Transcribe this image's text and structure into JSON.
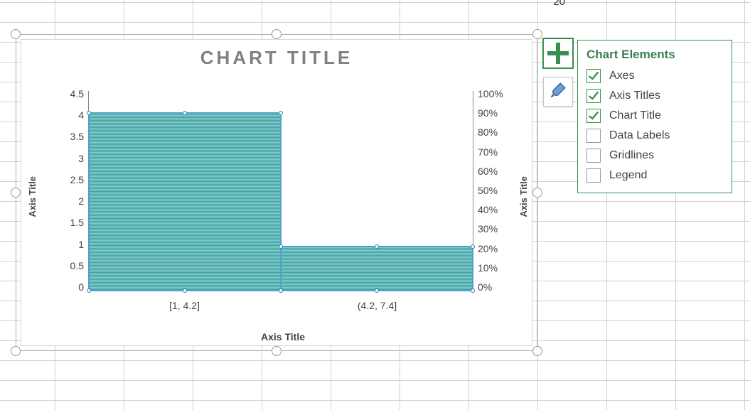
{
  "cell_top_right_value": "20",
  "chart": {
    "title": "CHART TITLE",
    "axis_title_left": "Axis Title",
    "axis_title_right": "Axis Title",
    "axis_title_bottom": "Axis Title",
    "yticks_left": [
      "4.5",
      "4",
      "3.5",
      "3",
      "2.5",
      "2",
      "1.5",
      "1",
      "0.5",
      "0"
    ],
    "yticks_right": [
      "100%",
      "90%",
      "80%",
      "70%",
      "60%",
      "50%",
      "40%",
      "30%",
      "20%",
      "10%",
      "0%"
    ],
    "xticks": [
      "[1, 4.2]",
      "(4.2, 7.4]"
    ]
  },
  "chart_data": {
    "type": "bar",
    "title": "CHART TITLE",
    "xlabel": "Axis Title",
    "ylabel": "Axis Title",
    "y2label": "Axis Title",
    "categories": [
      "[1, 4.2]",
      "(4.2, 7.4]"
    ],
    "values": [
      4,
      1
    ],
    "ylim": [
      0,
      4.5
    ],
    "y2lim_percent": [
      0,
      100
    ]
  },
  "fab": {
    "plus": "chart-elements",
    "brush": "chart-styles"
  },
  "popover": {
    "title": "Chart Elements",
    "items": [
      {
        "label": "Axes",
        "checked": true
      },
      {
        "label": "Axis Titles",
        "checked": true
      },
      {
        "label": "Chart Title",
        "checked": true
      },
      {
        "label": "Data Labels",
        "checked": false
      },
      {
        "label": "Gridlines",
        "checked": false
      },
      {
        "label": "Legend",
        "checked": false
      }
    ]
  }
}
